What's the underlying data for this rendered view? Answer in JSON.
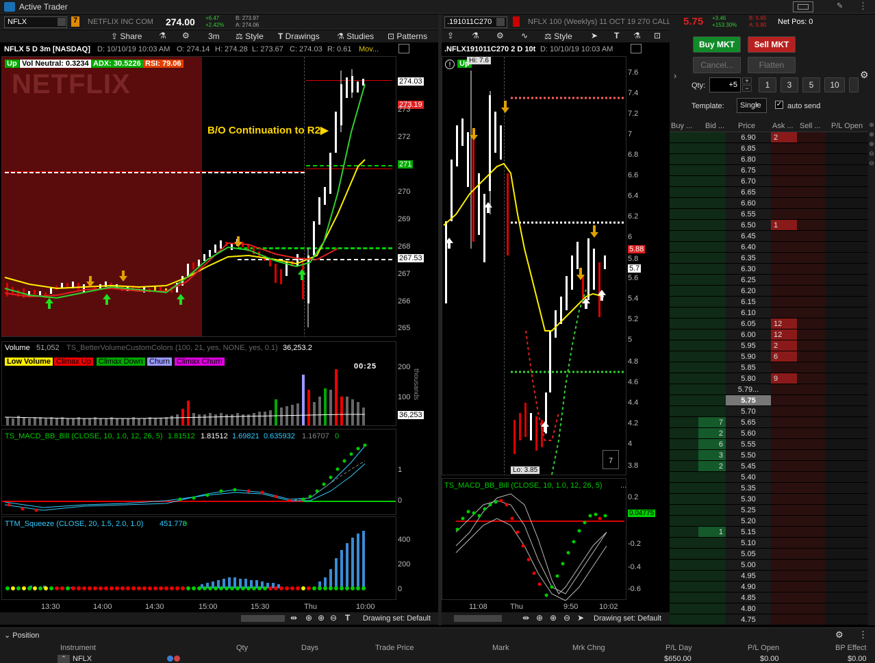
{
  "window": {
    "title": "Active Trader"
  },
  "left": {
    "symbol": "NFLX",
    "link_number": "7",
    "company": "NETFLIX INC COM",
    "last": "274.00",
    "change_abs": "+6.47",
    "change_pct": "+2.42%",
    "bid": "B: 273.97",
    "ask": "A: 274.06",
    "toolbar": {
      "share": "Share",
      "interval": "3m",
      "style": "Style",
      "drawings": "Drawings",
      "studies": "Studies",
      "patterns": "Patterns"
    },
    "chart_title": "NFLX 5 D 3m [NASDAQ]",
    "datetime": "D: 10/10/19 10:03 AM",
    "open": "O: 274.14",
    "high": "H: 274.28",
    "low": "L: 273.67",
    "close": "C: 274.03",
    "range": "R: 0.61",
    "mov": "Mov...",
    "badges": {
      "up": "Up",
      "vol": "Vol Neutral: 0.3234",
      "adx": "ADX: 30.5226",
      "rsi": "RSI: 79.06"
    },
    "watermark": "NETFLIX",
    "annotation": "B/O Continuation to R2",
    "price_labels": {
      "last": "274.03",
      "r2": "273.19",
      "green": "271",
      "white": "267.53"
    },
    "volume": {
      "label": "Volume",
      "value": "51,052",
      "study": "TS_BetterVolumeCustomColors (100, 21, yes, NONE, yes, 0.1)",
      "avg": "36,253.2",
      "legend": [
        "Low Volume",
        "Climax Up",
        "Climax Down",
        "Churn",
        "Climax Churn"
      ],
      "timer": "00:25",
      "axis_label": "thousands",
      "last_label": "36,253"
    },
    "macd": {
      "study": "TS_MACD_BB_Bill (CLOSE, 10, 1.0, 12, 26, 5)",
      "v1": "1.81512",
      "v2": "1.81512",
      "v3": "1.69821",
      "v4": "0.635932",
      "v5": "1.16707",
      "v6": "0"
    },
    "squeeze": {
      "study": "TTM_Squeeze (CLOSE, 20, 1.5, 2.0, 1.0)",
      "v1": "451.778",
      "v2": "0"
    },
    "time_axis": [
      "13:30",
      "14:00",
      "14:30",
      "15:00",
      "15:30",
      "Thu",
      "10:00"
    ],
    "drawing_set": "Drawing set: Default"
  },
  "right_chart": {
    "symbol": ".191011C270",
    "description": "NFLX 100 (Weeklys) 11 OCT 19 270 CALL",
    "last": "5.75",
    "change_abs": "+3.46",
    "change_pct": "+153.30%",
    "bid": "B: 5.65",
    "ask": "A: 5.80",
    "net_pos": "Net Pos: 0",
    "toolbar": {
      "style": "Style"
    },
    "chart_title": ".NFLX191011C270 2 D 10t",
    "datetime": "D: 10/10/19 10:03 AM",
    "badge_up": "Up",
    "hi": "Hi: 7.6",
    "lo": "Lo: 3.85",
    "price_labels": {
      "red": "5.88",
      "white": "5.7"
    },
    "box_num": "7",
    "macd": {
      "study": "TS_MACD_BB_Bill (CLOSE, 10, 1.0, 12, 26, 5)",
      "more": "...",
      "last_label": "0.04775"
    },
    "time_axis": [
      "11:08",
      "Thu",
      "9:50",
      "10:02"
    ],
    "drawing_set": "Drawing set: Default"
  },
  "order": {
    "buy": "Buy MKT",
    "sell": "Sell MKT",
    "cancel": "Cancel...",
    "flatten": "Flatten",
    "qty_label": "Qty:",
    "qty_value": "+5",
    "qty_presets": [
      "1",
      "3",
      "5",
      "10"
    ],
    "template_label": "Template:",
    "template_value": "Single",
    "auto_send": "auto send"
  },
  "ladder": {
    "headers": [
      "Buy ...",
      "Bid ...",
      "Price",
      "Ask ...",
      "Sell ...",
      "P/L Open"
    ],
    "rows": [
      {
        "price": "6.90",
        "bid": "",
        "ask": "2"
      },
      {
        "price": "6.85",
        "bid": "",
        "ask": ""
      },
      {
        "price": "6.80",
        "bid": "",
        "ask": ""
      },
      {
        "price": "6.75",
        "bid": "",
        "ask": ""
      },
      {
        "price": "6.70",
        "bid": "",
        "ask": ""
      },
      {
        "price": "6.65",
        "bid": "",
        "ask": ""
      },
      {
        "price": "6.60",
        "bid": "",
        "ask": ""
      },
      {
        "price": "6.55",
        "bid": "",
        "ask": ""
      },
      {
        "price": "6.50",
        "bid": "",
        "ask": "1"
      },
      {
        "price": "6.45",
        "bid": "",
        "ask": ""
      },
      {
        "price": "6.40",
        "bid": "",
        "ask": ""
      },
      {
        "price": "6.35",
        "bid": "",
        "ask": ""
      },
      {
        "price": "6.30",
        "bid": "",
        "ask": ""
      },
      {
        "price": "6.25",
        "bid": "",
        "ask": ""
      },
      {
        "price": "6.20",
        "bid": "",
        "ask": ""
      },
      {
        "price": "6.15",
        "bid": "",
        "ask": ""
      },
      {
        "price": "6.10",
        "bid": "",
        "ask": ""
      },
      {
        "price": "6.05",
        "bid": "",
        "ask": "12"
      },
      {
        "price": "6.00",
        "bid": "",
        "ask": "12"
      },
      {
        "price": "5.95",
        "bid": "",
        "ask": "2"
      },
      {
        "price": "5.90",
        "bid": "",
        "ask": "6"
      },
      {
        "price": "5.85",
        "bid": "",
        "ask": ""
      },
      {
        "price": "5.80",
        "bid": "",
        "ask": "9"
      },
      {
        "price": "5.79...",
        "bid": "",
        "ask": ""
      },
      {
        "price": "5.75",
        "bid": "",
        "ask": ""
      },
      {
        "price": "5.70",
        "bid": "",
        "ask": ""
      },
      {
        "price": "5.65",
        "bid": "7",
        "ask": ""
      },
      {
        "price": "5.60",
        "bid": "2",
        "ask": ""
      },
      {
        "price": "5.55",
        "bid": "6",
        "ask": ""
      },
      {
        "price": "5.50",
        "bid": "3",
        "ask": ""
      },
      {
        "price": "5.45",
        "bid": "2",
        "ask": ""
      },
      {
        "price": "5.40",
        "bid": "",
        "ask": ""
      },
      {
        "price": "5.35",
        "bid": "",
        "ask": ""
      },
      {
        "price": "5.30",
        "bid": "",
        "ask": ""
      },
      {
        "price": "5.25",
        "bid": "",
        "ask": ""
      },
      {
        "price": "5.20",
        "bid": "",
        "ask": ""
      },
      {
        "price": "5.15",
        "bid": "1",
        "ask": ""
      },
      {
        "price": "5.10",
        "bid": "",
        "ask": ""
      },
      {
        "price": "5.05",
        "bid": "",
        "ask": ""
      },
      {
        "price": "5.00",
        "bid": "",
        "ask": ""
      },
      {
        "price": "4.95",
        "bid": "",
        "ask": ""
      },
      {
        "price": "4.90",
        "bid": "",
        "ask": ""
      },
      {
        "price": "4.85",
        "bid": "",
        "ask": ""
      },
      {
        "price": "4.80",
        "bid": "",
        "ask": ""
      },
      {
        "price": "4.75",
        "bid": "",
        "ask": ""
      }
    ]
  },
  "position": {
    "title": "Position",
    "headers": [
      "Instrument",
      "Qty",
      "Days",
      "Trade Price",
      "Mark",
      "Mrk Chng",
      "P/L Day",
      "P/L Open",
      "BP Effect"
    ],
    "row": {
      "instrument": "NFLX",
      "pl_day": "$650.00",
      "pl_open": "$0.00",
      "bp_effect": "$0.00"
    }
  }
}
